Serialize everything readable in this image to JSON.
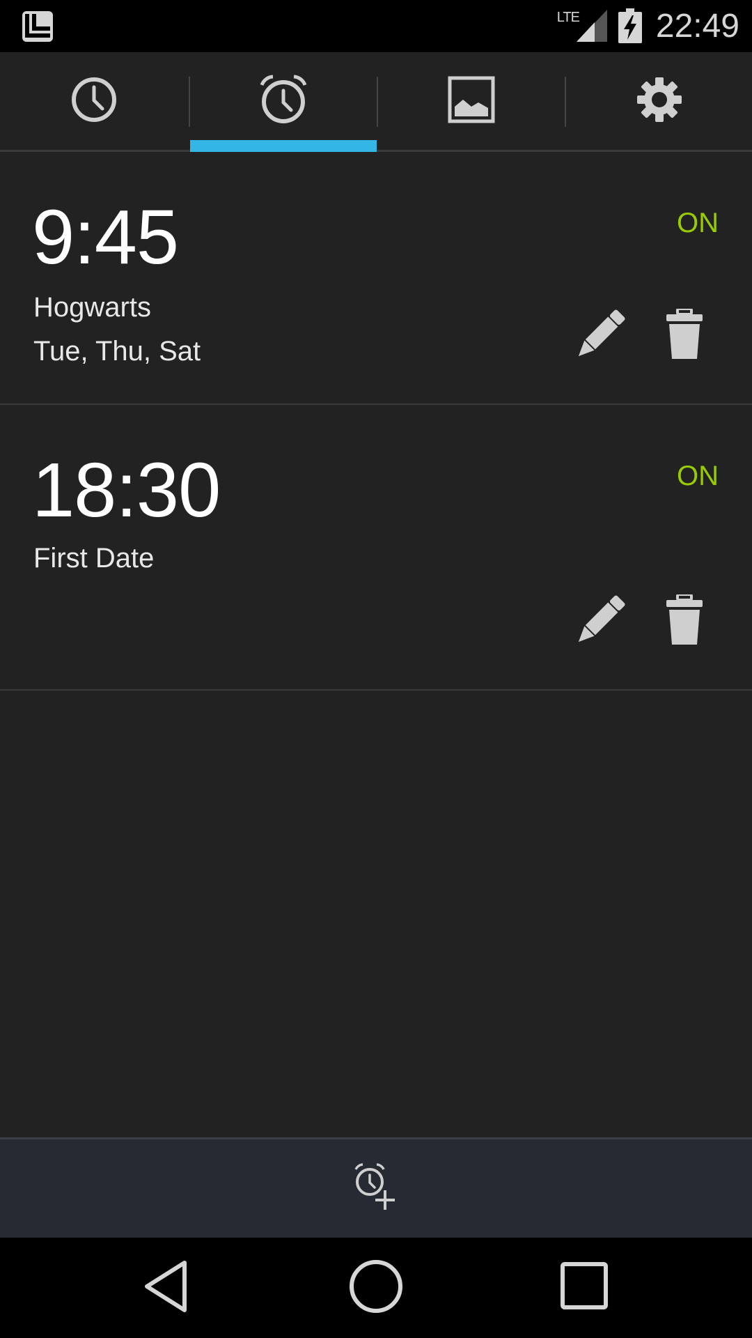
{
  "status_bar": {
    "network": "LTE",
    "time": "22:49",
    "icons": [
      "launcher-icon",
      "signal-icon",
      "battery-charging-icon"
    ]
  },
  "tabs": [
    {
      "name": "clock",
      "icon": "clock-icon",
      "selected": false
    },
    {
      "name": "alarms",
      "icon": "alarm-clock-icon",
      "selected": true
    },
    {
      "name": "wallpaper",
      "icon": "image-icon",
      "selected": false
    },
    {
      "name": "settings",
      "icon": "gear-icon",
      "selected": false
    }
  ],
  "alarms": [
    {
      "time": "9:45",
      "label": "Hogwarts",
      "days": "Tue, Thu, Sat",
      "status": "ON"
    },
    {
      "time": "18:30",
      "label": "First Date",
      "days": "",
      "status": "ON"
    }
  ],
  "add_alarm": {
    "icon": "add-alarm-icon"
  },
  "nav": {
    "icons": [
      "back-icon",
      "home-icon",
      "recents-icon"
    ]
  },
  "colors": {
    "accent": "#33b5e5",
    "status_on": "#99cc00",
    "background": "#222222",
    "add_bar": "#262a32"
  }
}
